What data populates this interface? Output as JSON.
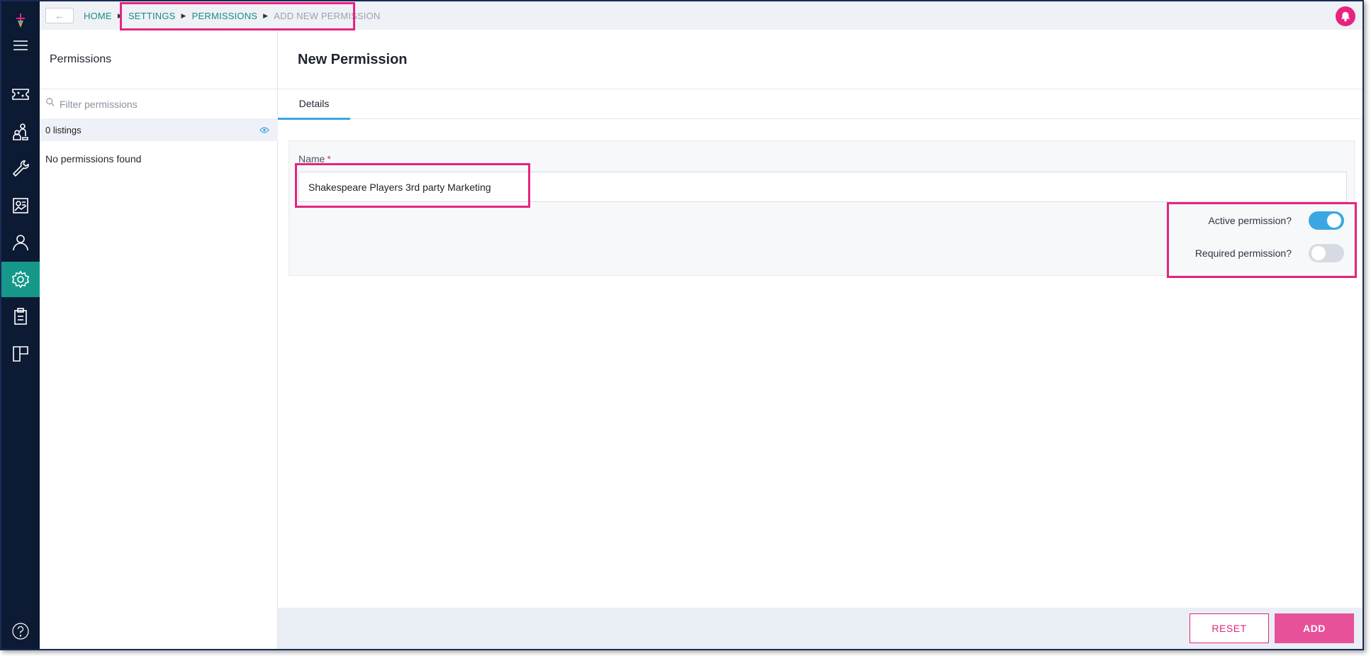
{
  "breadcrumb": {
    "items": [
      "HOME",
      "SETTINGS",
      "PERMISSIONS"
    ],
    "current": "ADD NEW PERMISSION"
  },
  "rail": {
    "icons": [
      "logo-icon",
      "menu-icon",
      "ticket-icon",
      "people-icon",
      "wrench-icon",
      "report-icon",
      "user-icon",
      "gear-icon",
      "clipboard-icon",
      "layout-icon",
      "help-icon"
    ],
    "active": "gear-icon",
    "active_color": "#15988a"
  },
  "side": {
    "title": "Permissions",
    "filter_placeholder": "Filter permissions",
    "listings": "0 listings",
    "empty": "No permissions found"
  },
  "main": {
    "title": "New Permission",
    "tabs": [
      {
        "label": "Details",
        "active": true
      }
    ],
    "form": {
      "name_label": "Name",
      "required_marker": "*",
      "name_value": "Shakespeare Players 3rd party Marketing",
      "toggles": [
        {
          "label": "Active permission?",
          "on": true
        },
        {
          "label": "Required permission?",
          "on": false
        }
      ]
    }
  },
  "footer": {
    "reset_label": "RESET",
    "add_label": "ADD"
  },
  "colors": {
    "accent_pink": "#e6247f",
    "teal": "#1b8c80",
    "toggle_blue": "#3ba7e2",
    "rail_bg": "#0c1a33"
  }
}
